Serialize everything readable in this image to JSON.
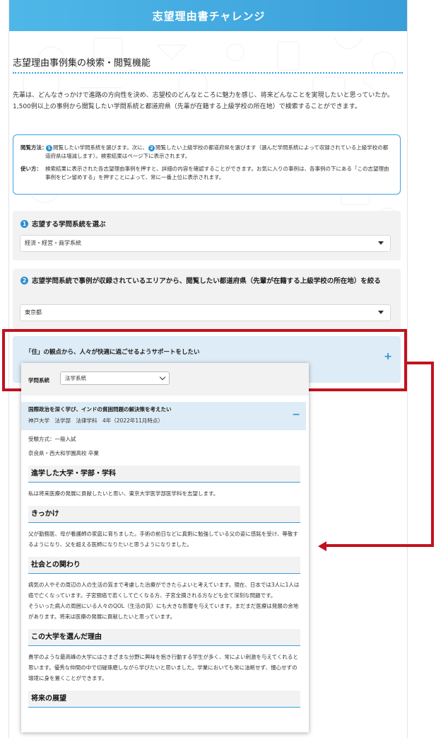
{
  "header": {
    "title": "志望理由書チャレンジ"
  },
  "section": {
    "title": "志望理由事例集の検索・閲覧機能"
  },
  "intro": {
    "p1": "先輩は、どんなきっかけで進路の方向性を決め、志望校のどんなところに魅力を感じ、将来どんなことを実現したいと思っていたか。",
    "p2": "1,500例以上の事例から閲覧したい学問系統と都道府県（先輩が在籍する上級学校の所在地）で検索することができます。"
  },
  "infobox": {
    "method_key": "閲覧方法：",
    "method_a": "閲覧したい学問系統を選びます。次に、",
    "method_b": "閲覧したい上級学校の都道府県を選びます（選んだ学問系統によって収録されている上級学校の都道府県は増減します）。検索結果はページ下に表示されます。",
    "usage_key": "使い方：",
    "usage_text": "検索結果に表示された各志望理由事例を押すと、詳細の内容を確認することができます。お気に入りの事例は、各事例の下にある「この志望理由事例をピン留めする」を押すことによって、常に一番上位に表示されます。",
    "badge1": "1",
    "badge2": "2"
  },
  "step1": {
    "badge": "1",
    "label": "志望する学問系統を選ぶ",
    "selected": "経済・経営・商学系統"
  },
  "step2": {
    "badge": "2",
    "label": "志望学問系統で事例が収録されているエリアから、閲覧したい都道府県（先輩が在籍する上級学校の所在地）を絞る",
    "selected": "東京都"
  },
  "accordion": {
    "title": "「住」の観点から、人々が快適に過ごせるようサポートをしたい",
    "toggle": "+"
  },
  "popup": {
    "filter_label": "学問系統",
    "filter_selected": "法学系統",
    "case_title": "国際政治を深く学び、インドの貧困問題の解決策を考えたい",
    "case_meta": "神戸大学　法学部　法律学科　4年（2022年11月時点）",
    "toggle": "−",
    "exam_method": "受験方式：一般入試",
    "school": "奈良県・西大和学園高校 卒業",
    "sections": [
      {
        "heading": "進学した大学・学部・学科",
        "text": "私は将来医療の発展に貢献したいと思い、東京大学医学部医学科を志望します。"
      },
      {
        "heading": "きっかけ",
        "text": "父が勤務医、母が看護師の家庭に育ちました。手術の前日などに真剣に勉強している父の姿に感銘を受け、尊敬するようになり、父を超える医師になりたいと思うようになりました。"
      },
      {
        "heading": "社会との関わり",
        "text": "病気の人やその周辺の人の生活の質まで考慮した治療ができたらよいと考えています。現在、日本では3人に1人は癌で亡くなっています。子宮頸癌で若くして亡くなる方、子宮全摘される方なども全て深刻な問題です。\nそういった病人の周囲にいる人々のQOL（生活の質）にも大きな影響を与えています。まだまだ医療は発展の余地があります。将来は医療の発展に貢献したいと思っています。"
      },
      {
        "heading": "この大学を選んだ理由",
        "text": "貴学のような最高峰の大学にはさまざまな分野に興味を抱き行動する学生が多く、常によい刺激を与えてくれると思います。優秀な仲間の中で切磋琢磨しながら学びたいと思いました。学業においても常に油断せず、慢心せずの環境に身を置くことができます。"
      },
      {
        "heading": "将来の展望",
        "text": ""
      }
    ]
  },
  "colors": {
    "accent": "#39a3df",
    "annotation": "#c1121f",
    "header": "#4fb7e8"
  }
}
